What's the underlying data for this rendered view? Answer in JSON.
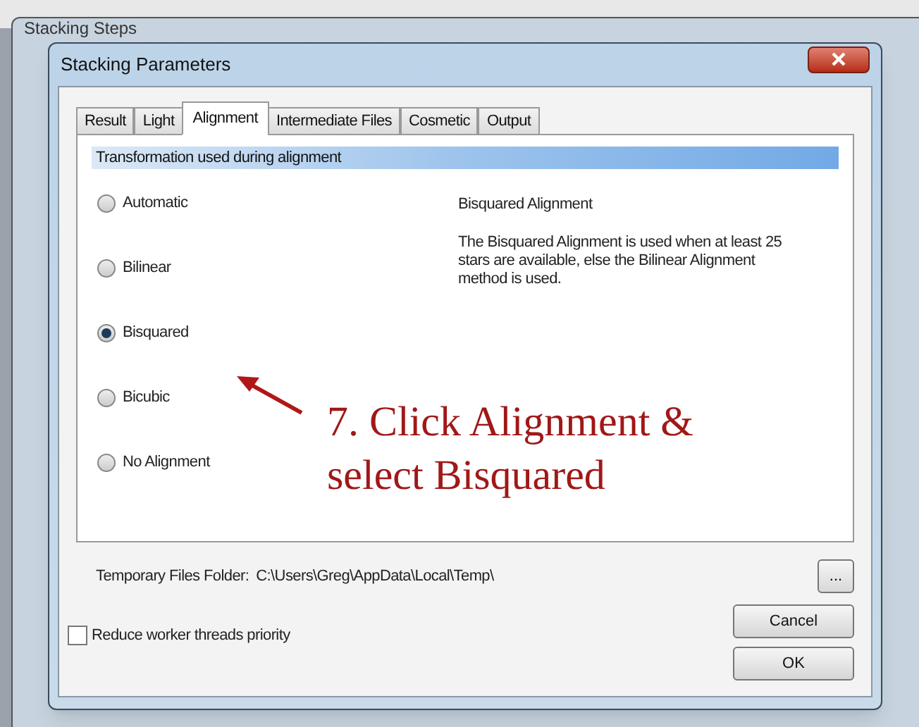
{
  "background_window": {
    "title": "Stacking Steps"
  },
  "window": {
    "title": "Stacking Parameters"
  },
  "tabs": [
    {
      "label": "Result",
      "selected": false
    },
    {
      "label": "Light",
      "selected": false
    },
    {
      "label": "Alignment",
      "selected": true
    },
    {
      "label": "Intermediate Files",
      "selected": false
    },
    {
      "label": "Cosmetic",
      "selected": false
    },
    {
      "label": "Output",
      "selected": false
    }
  ],
  "group": {
    "title": "Transformation used during alignment",
    "options": [
      {
        "label": "Automatic",
        "selected": false
      },
      {
        "label": "Bilinear",
        "selected": false
      },
      {
        "label": "Bisquared",
        "selected": true
      },
      {
        "label": "Bicubic",
        "selected": false
      },
      {
        "label": "No Alignment",
        "selected": false
      }
    ]
  },
  "description": {
    "title": "Bisquared Alignment",
    "text": "The Bisquared Alignment is used when at least 25 stars are available, else the Bilinear Alignment method is used."
  },
  "annotation": {
    "lines": [
      "7. Click Alignment &",
      "select Bisquared"
    ]
  },
  "temp_folder": {
    "label": "Temporary Files Folder:",
    "value": "C:\\Users\\Greg\\AppData\\Local\\Temp\\"
  },
  "browse_button": "...",
  "reduce_priority": {
    "label": "Reduce worker threads priority",
    "checked": false
  },
  "buttons": [
    "Cancel",
    "OK"
  ]
}
